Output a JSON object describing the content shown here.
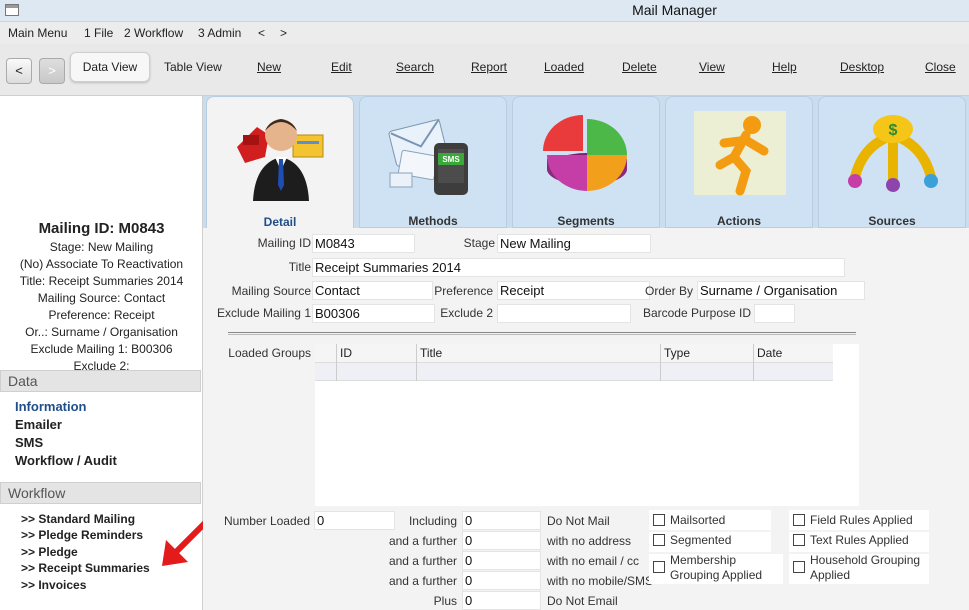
{
  "window": {
    "title": "Mail Manager"
  },
  "menu": {
    "main": "Main Menu",
    "file": "1 File",
    "workflow": "2 Workflow",
    "admin": "3 Admin",
    "back": "<",
    "forward": ">"
  },
  "toolbar": {
    "back": "<",
    "forward": ">",
    "data_view": "Data View",
    "table_view": "Table View",
    "new": "New",
    "edit": "Edit",
    "search": "Search",
    "report": "Report",
    "loaded": "Loaded",
    "delete": "Delete",
    "view": "View",
    "help": "Help",
    "desktop": "Desktop",
    "close": "Close"
  },
  "summary": {
    "mailing_id": "Mailing ID: M0843",
    "lines": [
      "Stage: New Mailing",
      "(No) Associate To Reactivation",
      "Title: Receipt Summaries 2014",
      "Mailing Source: Contact",
      "Preference: Receipt",
      "Or..: Surname / Organisation",
      "Exclude Mailing 1: B00306",
      "Exclude 2:"
    ]
  },
  "sidebar": {
    "data_header": "Data",
    "data_items": [
      "Information",
      "Emailer",
      "SMS",
      "Workflow / Audit"
    ],
    "workflow_header": "Workflow",
    "workflow_items": [
      ">> Standard Mailing",
      ">> Pledge Reminders",
      ">> Pledge",
      ">> Receipt Summaries",
      ">> Invoices"
    ]
  },
  "tabs": {
    "detail": "Detail",
    "methods": "Methods",
    "segments": "Segments",
    "actions": "Actions",
    "sources": "Sources",
    "sms_badge": "SMS"
  },
  "form": {
    "mailing_id_label": "Mailing ID",
    "mailing_id": "M0843",
    "stage_label": "Stage",
    "stage": "New Mailing",
    "title_label": "Title",
    "title": "Receipt Summaries 2014",
    "mailing_source_label": "Mailing Source",
    "mailing_source": "Contact",
    "preference_label": "Preference",
    "preference": "Receipt",
    "order_by_label": "Order By",
    "order_by": "Surname / Organisation",
    "exclude1_label": "Exclude Mailing 1",
    "exclude1": "B00306",
    "exclude2_label": "Exclude 2",
    "exclude2": "",
    "barcode_label": "Barcode Purpose ID",
    "barcode": ""
  },
  "loaded_groups": {
    "label": "Loaded Groups",
    "columns": [
      "ID",
      "Title",
      "Type",
      "Date"
    ]
  },
  "counts": {
    "number_loaded_label": "Number Loaded",
    "number_loaded": "0",
    "rows": [
      {
        "prefix": "Including",
        "value": "0",
        "suffix": "Do Not Mail"
      },
      {
        "prefix": "and a further",
        "value": "0",
        "suffix": "with no address"
      },
      {
        "prefix": "and a further",
        "value": "0",
        "suffix": "with no email / cc"
      },
      {
        "prefix": "and a further",
        "value": "0",
        "suffix": "with no mobile/SMS"
      },
      {
        "prefix": "Plus",
        "value": "0",
        "suffix": "Do Not Email"
      }
    ]
  },
  "checks": {
    "mailsorted": "Mailsorted",
    "segmented": "Segmented",
    "membership_grouping": "Membership Grouping Applied",
    "field_rules": "Field Rules Applied",
    "text_rules": "Text Rules Applied",
    "household_grouping": "Household Grouping Applied"
  },
  "colors": {
    "accent": "#1f4e89",
    "arrow": "#e31b1b",
    "tabstrip": "#c9ddef"
  }
}
